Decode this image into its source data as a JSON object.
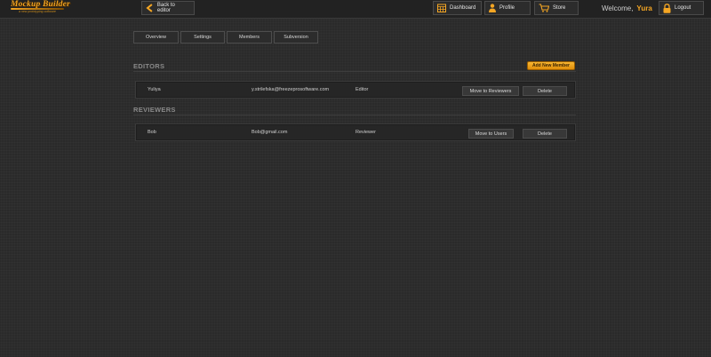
{
  "app": {
    "logo_title": "Mockup Builder",
    "logo_tagline": "a new prototyping software"
  },
  "toolbar": {
    "back_label": "Back to editor",
    "dashboard_label": "Dashboard",
    "profile_label": "Profile",
    "store_label": "Store",
    "welcome_text": "Welcome,",
    "user_name": "Yura",
    "logout_label": "Logout"
  },
  "tabs": [
    {
      "label": "Overview"
    },
    {
      "label": "Settings"
    },
    {
      "label": "Members"
    },
    {
      "label": "Subversion"
    }
  ],
  "editors": {
    "title": "EDITORS",
    "add_label": "Add New Member",
    "members": [
      {
        "name": "Yuliya",
        "email": "y.strilefska@freezeprosoftware.com",
        "role": "Editor",
        "move_label": "Move to Reviewers",
        "delete_label": "Delete"
      }
    ]
  },
  "reviewers": {
    "title": "REVIEWERS",
    "members": [
      {
        "name": "Bob",
        "email": "Bob@gmail.com",
        "role": "Reviewer",
        "move_label": "Move to Users",
        "delete_label": "Delete"
      }
    ]
  },
  "colors": {
    "accent": "#f5a623",
    "background": "#2a2a2a"
  },
  "icons": {
    "back": "chevron-left-icon",
    "dashboard": "calendar-icon",
    "profile": "user-icon",
    "store": "cart-icon",
    "logout": "lock-icon"
  }
}
